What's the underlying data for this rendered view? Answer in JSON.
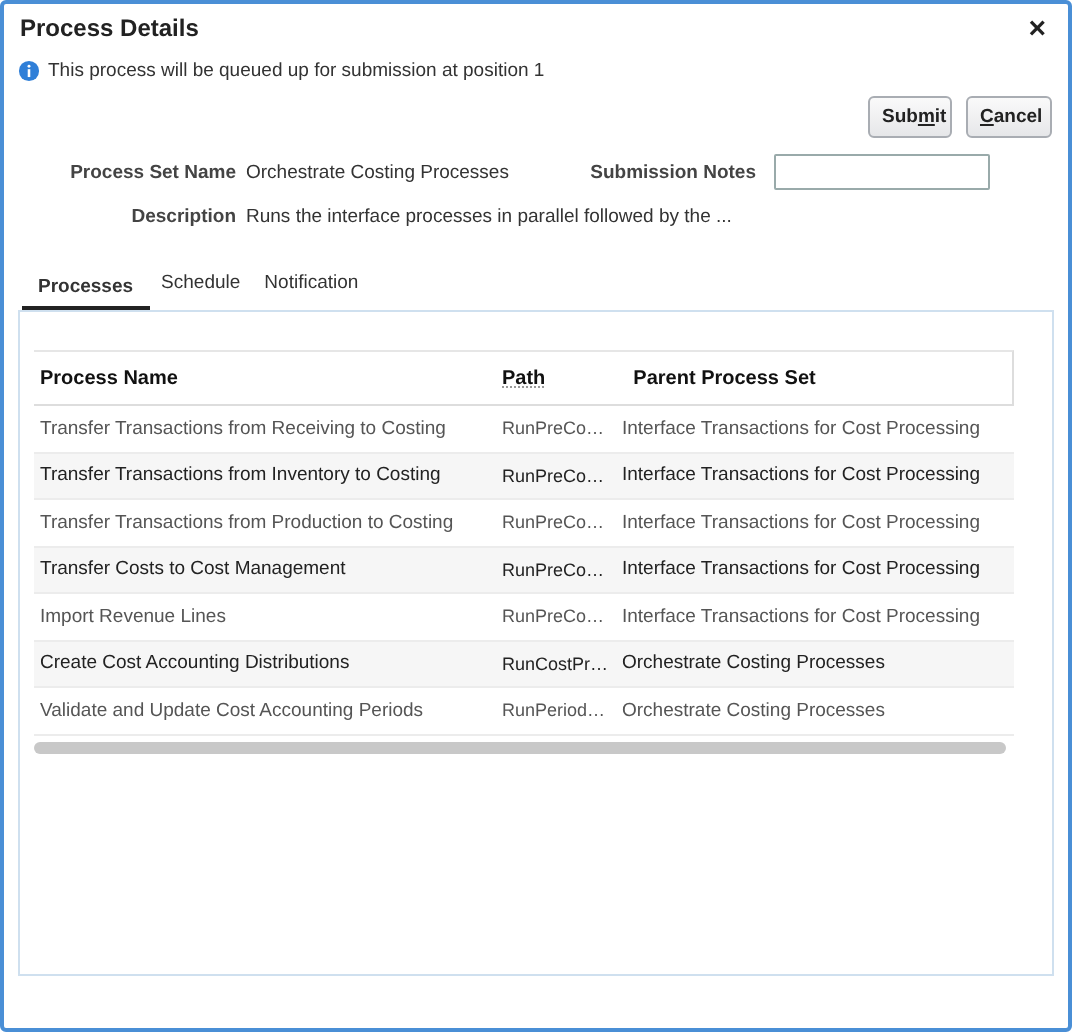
{
  "dialog": {
    "title": "Process Details",
    "close": "×"
  },
  "info": "This process will be queued up for submission at position 1",
  "buttons": [
    {
      "kind": "primary",
      "label": {
        "before": "Sub",
        "key": "m",
        "after": "it"
      }
    },
    {
      "kind": "secondary",
      "label": {
        "key": "C",
        "after": "ancel"
      }
    }
  ],
  "fields": {
    "process_set_name": {
      "label": "Process Set Name",
      "value": "Orchestrate Costing Processes"
    },
    "submission_notes": {
      "label": "Submission Notes"
    },
    "description": {
      "label": "Description",
      "value": "Runs the interface processes in parallel followed by the ..."
    }
  },
  "tabs": [
    {
      "label": "Processes",
      "selected": true
    },
    {
      "label": "Schedule",
      "selected": false
    },
    {
      "label": "Notification",
      "selected": false
    }
  ],
  "table": {
    "columns": [
      "Process Name",
      "Path",
      "Parent Process Set"
    ],
    "rows": [
      [
        "Transfer Transactions from Receiving to Costing",
        "RunPreCo…",
        "Interface Transactions for Cost Processing"
      ],
      [
        "Transfer Transactions from Inventory to Costing",
        "RunPreCo…",
        "Interface Transactions for Cost Processing"
      ],
      [
        "Transfer Transactions from Production to Costing",
        "RunPreCo…",
        "Interface Transactions for Cost Processing"
      ],
      [
        "Transfer Costs to Cost Management",
        "RunPreCo…",
        "Interface Transactions for Cost Processing"
      ],
      [
        "Import Revenue Lines",
        "RunPreCo…",
        "Interface Transactions for Cost Processing"
      ],
      [
        "Create Cost Accounting Distributions",
        "RunCostPr…",
        "Orchestrate Costing Processes"
      ],
      [
        "Validate and Update Cost Accounting Periods",
        "RunPeriod…",
        "Orchestrate Costing Processes"
      ]
    ]
  }
}
